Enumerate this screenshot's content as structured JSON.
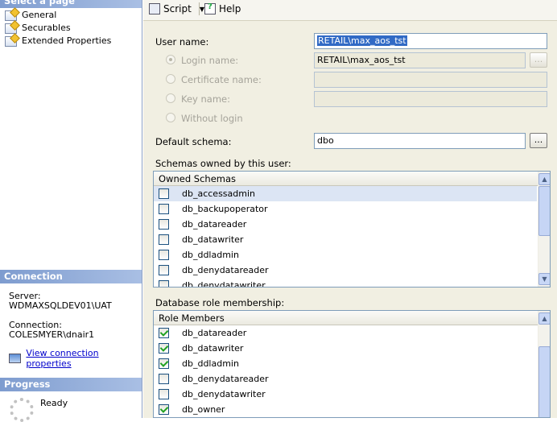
{
  "left": {
    "select_page_header": "Select a page",
    "pages": [
      {
        "label": "General"
      },
      {
        "label": "Securables"
      },
      {
        "label": "Extended Properties"
      }
    ],
    "connection_header": "Connection",
    "server_label": "Server:",
    "server_value": "WDMAXSQLDEV01\\UAT",
    "connection_label": "Connection:",
    "connection_value": "COLESMYER\\dnair1",
    "view_connection_link": "View connection properties",
    "progress_header": "Progress",
    "progress_status": "Ready"
  },
  "toolbar": {
    "script_label": "Script",
    "help_label": "Help"
  },
  "form": {
    "user_name_label": "User name:",
    "user_name_value": "RETAIL\\max_aos_tst",
    "login_name_label": "Login name:",
    "login_name_value": "RETAIL\\max_aos_tst",
    "certificate_name_label": "Certificate name:",
    "key_name_label": "Key name:",
    "without_login_label": "Without login",
    "default_schema_label": "Default schema:",
    "default_schema_value": "dbo",
    "ellipsis": "..."
  },
  "schemas": {
    "section_label": "Schemas owned by this user:",
    "column_header": "Owned Schemas",
    "rows": [
      {
        "name": "db_accessadmin",
        "checked": false,
        "selected": true
      },
      {
        "name": "db_backupoperator",
        "checked": false
      },
      {
        "name": "db_datareader",
        "checked": false
      },
      {
        "name": "db_datawriter",
        "checked": false
      },
      {
        "name": "db_ddladmin",
        "checked": false
      },
      {
        "name": "db_denydatareader",
        "checked": false
      },
      {
        "name": "db_denydatawriter",
        "checked": false
      }
    ]
  },
  "roles": {
    "section_label": "Database role membership:",
    "column_header": "Role Members",
    "rows": [
      {
        "name": "db_datareader",
        "checked": true
      },
      {
        "name": "db_datawriter",
        "checked": true
      },
      {
        "name": "db_ddladmin",
        "checked": true
      },
      {
        "name": "db_denydatareader",
        "checked": false
      },
      {
        "name": "db_denydatawriter",
        "checked": false
      },
      {
        "name": "db_owner",
        "checked": true
      }
    ]
  },
  "icons": {
    "scroll_up": "▲",
    "scroll_down": "▼"
  }
}
